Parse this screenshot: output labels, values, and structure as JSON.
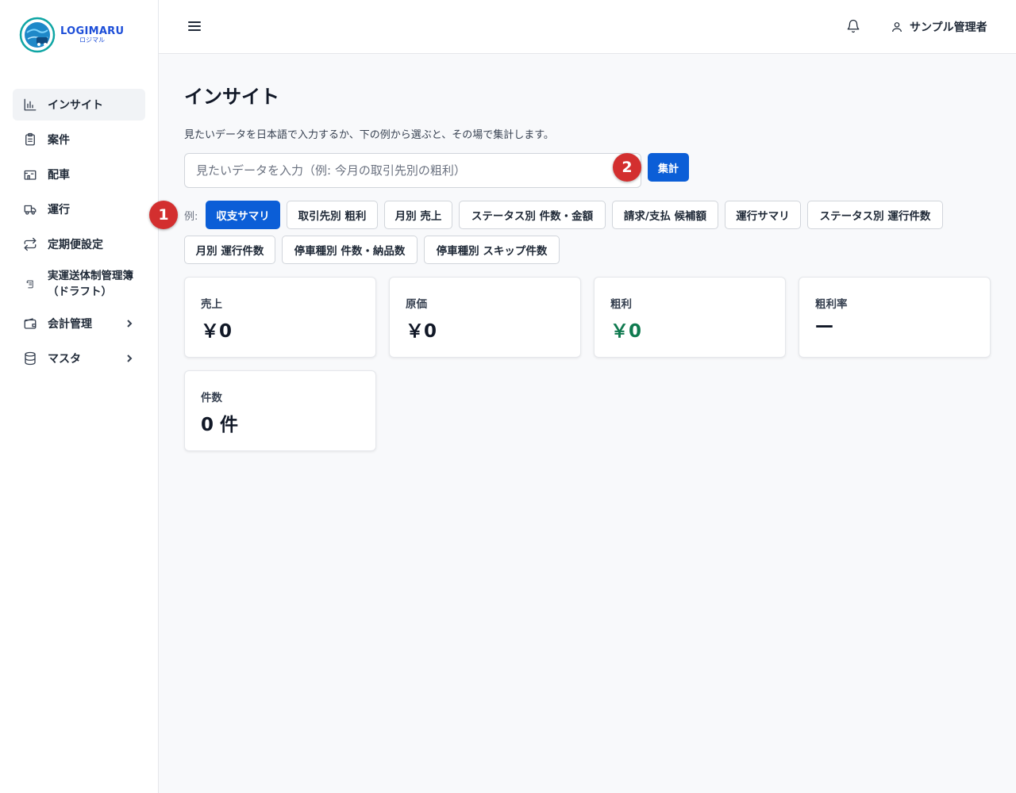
{
  "logo": {
    "name": "LOGIMARU",
    "sub": "ロジマル"
  },
  "sidebar": {
    "items": [
      {
        "label": "インサイト",
        "icon": "bar-chart-icon"
      },
      {
        "label": "案件",
        "icon": "clipboard-icon"
      },
      {
        "label": "配車",
        "icon": "factory-icon"
      },
      {
        "label": "運行",
        "icon": "truck-icon"
      },
      {
        "label": "定期便設定",
        "icon": "repeat-icon"
      },
      {
        "label": "実運送体制管理簿\n（ドラフト）",
        "icon": "scroll-icon"
      },
      {
        "label": "会計管理",
        "icon": "wallet-icon"
      },
      {
        "label": "マスタ",
        "icon": "database-icon"
      }
    ]
  },
  "header": {
    "user_name": "サンプル管理者"
  },
  "page": {
    "title": "インサイト",
    "description": "見たいデータを日本語で入力するか、下の例から選ぶと、その場で集計します。",
    "search_placeholder": "見たいデータを入力（例: 今月の取引先別の粗利）",
    "run_label": "集計",
    "examples_label": "例:",
    "examples": [
      "収支サマリ",
      "取引先別 粗利",
      "月別 売上",
      "ステータス別 件数・金額",
      "請求/支払 候補額",
      "運行サマリ",
      "ステータス別 運行件数",
      "月別 運行件数",
      "停車種別 件数・納品数",
      "停車種別 スキップ件数"
    ]
  },
  "badges": {
    "one": "1",
    "two": "2"
  },
  "cards": [
    {
      "label": "売上",
      "value": "￥0"
    },
    {
      "label": "原価",
      "value": "￥0"
    },
    {
      "label": "粗利",
      "value": "￥0"
    },
    {
      "label": "粗利率",
      "value": "—"
    },
    {
      "label": "件数",
      "value": "0 件"
    }
  ],
  "colors": {
    "primary": "#0b5ed7",
    "profit": "#0f7a4f",
    "badge": "#d32f2f"
  }
}
